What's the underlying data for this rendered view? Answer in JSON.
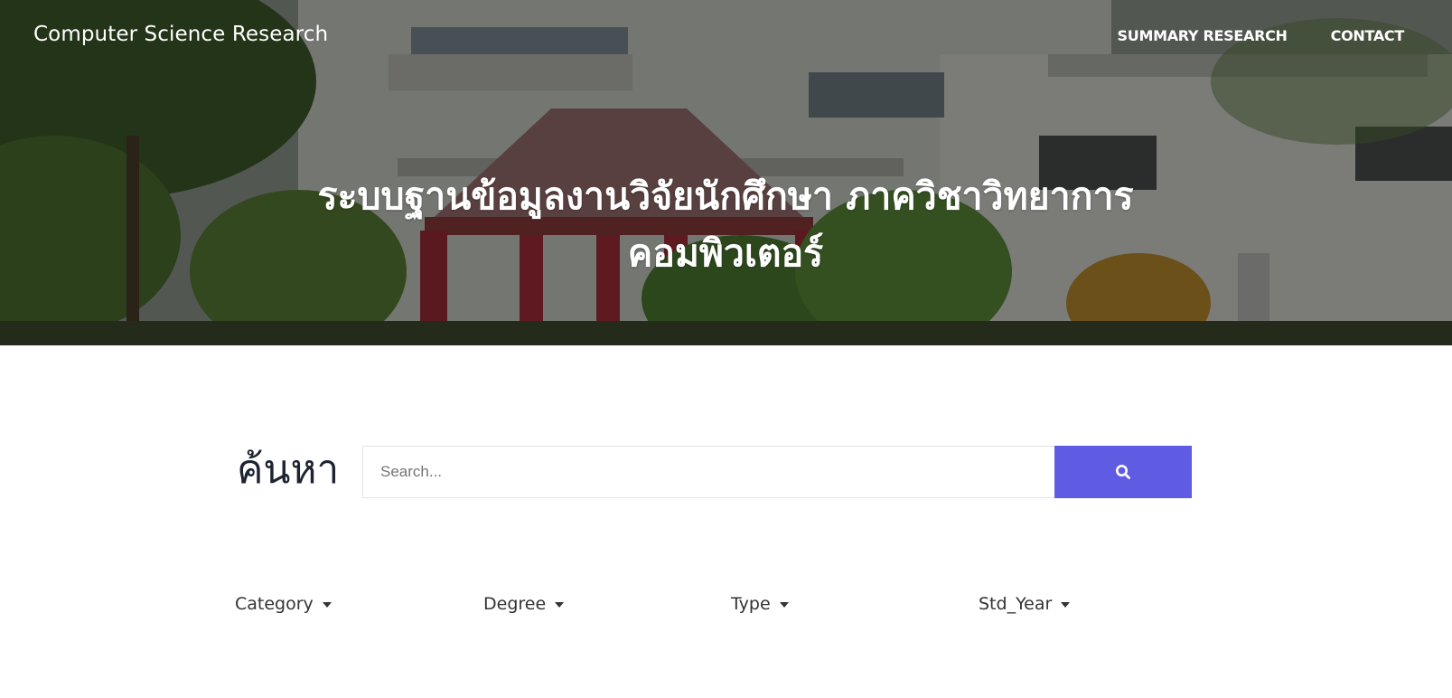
{
  "header": {
    "brand": "Computer Science Research",
    "nav": [
      {
        "label": "SUMMARY RESEARCH"
      },
      {
        "label": "CONTACT"
      }
    ]
  },
  "hero": {
    "title_line1": "ระบบฐานข้อมูลงานวิจัยนักศึกษา ภาควิชาวิทยาการ",
    "title_line2": "คอมพิวเตอร์"
  },
  "search": {
    "label": "ค้นหา",
    "placeholder": "Search...",
    "value": "",
    "button_icon": "search-icon",
    "button_color": "#5f5be3"
  },
  "filters": [
    {
      "label": "Category",
      "icon": "caret-down-icon"
    },
    {
      "label": "Degree",
      "icon": "caret-down-icon"
    },
    {
      "label": "Type",
      "icon": "caret-down-icon"
    },
    {
      "label": "Std_Year",
      "icon": "caret-down-icon"
    }
  ]
}
